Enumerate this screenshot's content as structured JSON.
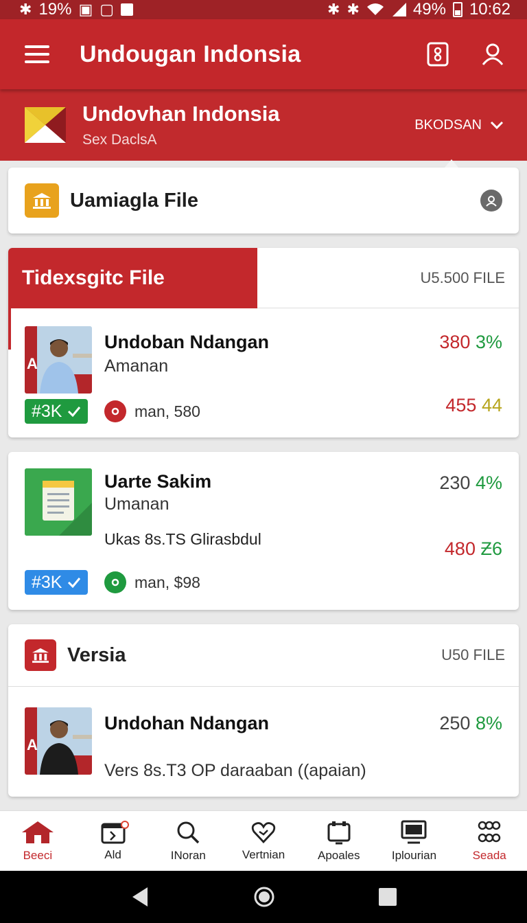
{
  "status_bar": {
    "left_battery": "19%",
    "right_battery": "49%",
    "time": "10:62"
  },
  "app_bar": {
    "title": "Undougan Indonsia",
    "icons": [
      "menu-icon",
      "phone-icon",
      "profile-icon"
    ]
  },
  "brand": {
    "name": "Undovhan Indonsia",
    "subtitle": "Sex DaclsA",
    "dropdown_label": "BKODSAN"
  },
  "search_card": {
    "title": "Uamiagla File"
  },
  "section": {
    "tab_label": "Tidexsgitc File",
    "count": "U5.500 FILE"
  },
  "items": [
    {
      "title": "Undoban Ndangan",
      "subtitle": "Amanan",
      "num_a": "380",
      "num_b": "3%",
      "num_c": "455",
      "num_d": "44",
      "badge": "#3K",
      "meta": "man, 580"
    },
    {
      "title": "Uarte Sakim",
      "subtitle": "Umanan",
      "desc": "Ukas 8s.TS Glirasbdul",
      "num_a": "230",
      "num_b": "4%",
      "num_c": "480",
      "num_d": "Ƶ6",
      "badge": "#3K",
      "meta": "man, $98"
    }
  ],
  "versia": {
    "title": "Versia",
    "count": "U50 FILE",
    "item": {
      "title": "Undohan Ndangan",
      "num_a": "250",
      "num_b": "8%",
      "desc": "Vers 8s.T3 OP daraaban ((apaian)"
    }
  },
  "bottom_nav": [
    {
      "label": "Beeci",
      "icon": "home-icon"
    },
    {
      "label": "Ald",
      "icon": "calendar-icon"
    },
    {
      "label": "INoran",
      "icon": "search-icon"
    },
    {
      "label": "Vertnian",
      "icon": "heart-icon"
    },
    {
      "label": "Apoales",
      "icon": "clipboard-icon"
    },
    {
      "label": "Iplourian",
      "icon": "monitor-icon"
    },
    {
      "label": "Seada",
      "icon": "link-icon"
    }
  ],
  "colors": {
    "primary_red": "#c3272b",
    "status_red": "#9e2226",
    "green": "#1f9a3f",
    "blue": "#2f8be6",
    "olive": "#b7a51d"
  }
}
